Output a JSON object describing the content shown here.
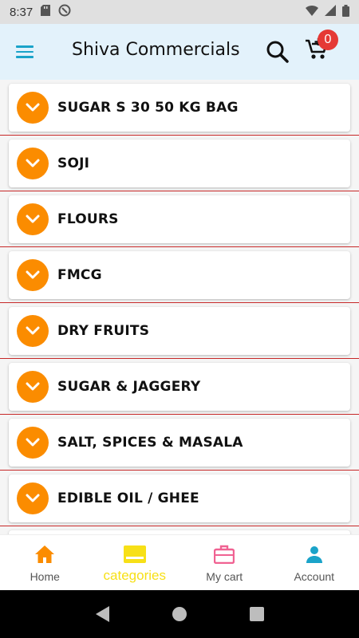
{
  "status_bar": {
    "time": "8:37"
  },
  "app_bar": {
    "title": "Shiva Commercials",
    "cart_count": "0"
  },
  "categories": [
    {
      "label": "SUGAR S 30 50 KG BAG"
    },
    {
      "label": "SOJI"
    },
    {
      "label": "FLOURS"
    },
    {
      "label": "FMCG"
    },
    {
      "label": "DRY FRUITS"
    },
    {
      "label": "SUGAR & JAGGERY"
    },
    {
      "label": "SALT, SPICES & MASALA"
    },
    {
      "label": "EDIBLE OIL / GHEE"
    }
  ],
  "bottom_nav": {
    "home": "Home",
    "categories": "categories",
    "cart": "My cart",
    "account": "Account"
  },
  "colors": {
    "accent": "#fb8c00",
    "primary": "#1aa3c9",
    "active_tab": "#f7e017",
    "badge": "#e53935",
    "divider": "#c62828"
  }
}
